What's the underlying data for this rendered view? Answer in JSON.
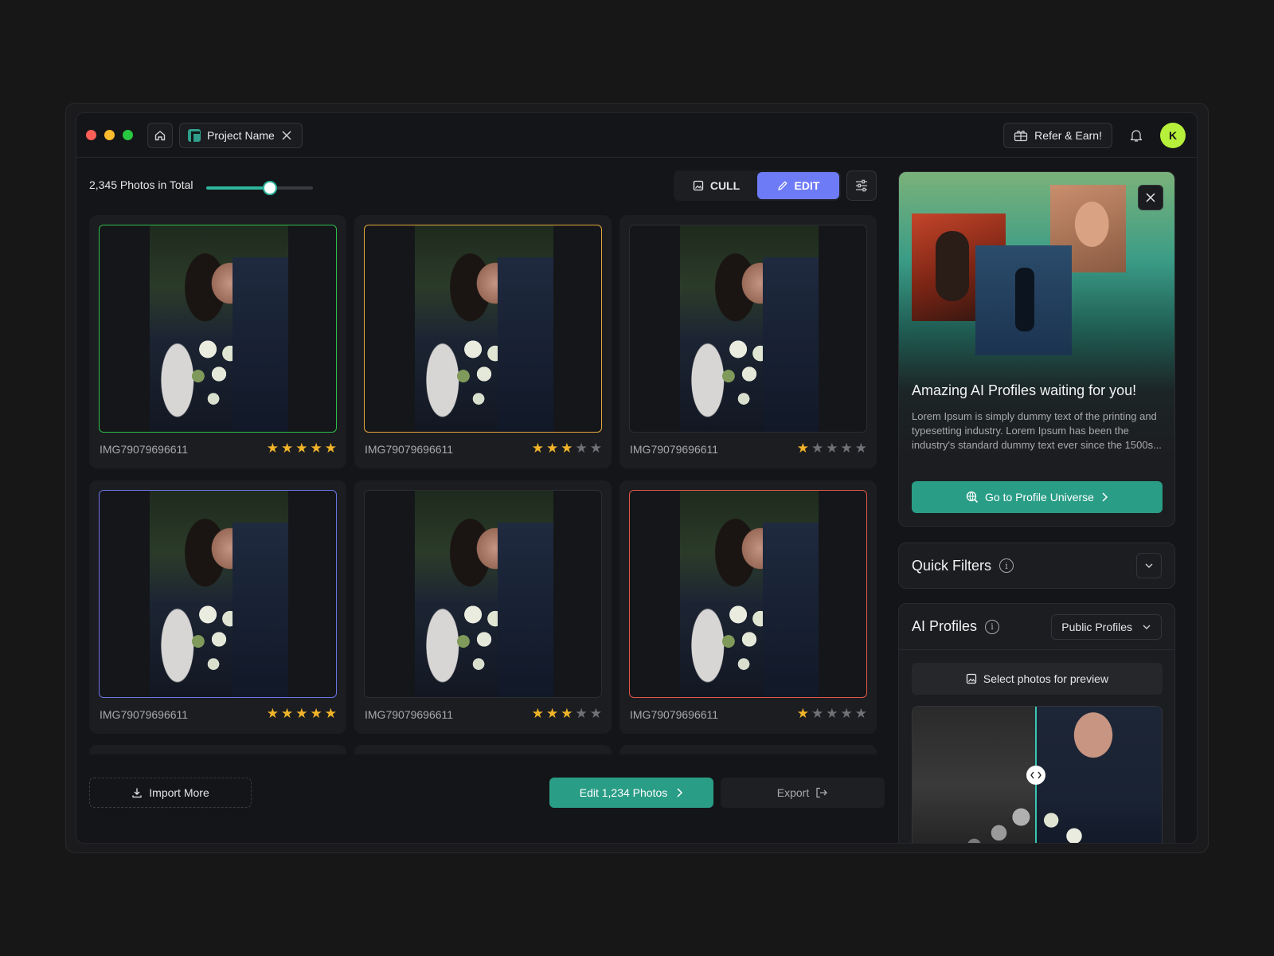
{
  "window": {
    "tab_title": "Project Name",
    "refer_label": "Refer & Earn!",
    "avatar_initial": "K"
  },
  "toolbar": {
    "photos_count": "2,345 Photos in Total",
    "zoom_level": 0.6,
    "cull_label": "CULL",
    "edit_label": "EDIT",
    "active_mode": "EDIT"
  },
  "grid": {
    "photos": [
      {
        "name": "IMG79079696611",
        "rating": 5,
        "border": "#2fbf4a"
      },
      {
        "name": "IMG79079696611",
        "rating": 3,
        "border": "#e2a93b"
      },
      {
        "name": "IMG79079696611",
        "rating": 1,
        "border": "#2c2d32"
      },
      {
        "name": "IMG79079696611",
        "rating": 5,
        "border": "#6c74e8"
      },
      {
        "name": "IMG79079696611",
        "rating": 3,
        "border": "#2c2d32"
      },
      {
        "name": "IMG79079696611",
        "rating": 1,
        "border": "#e0574a"
      }
    ]
  },
  "bottom": {
    "import_label": "Import More",
    "edit_label": "Edit 1,234 Photos",
    "export_label": "Export"
  },
  "promo": {
    "title": "Amazing AI Profiles waiting for you!",
    "body": "Lorem Ipsum is simply dummy text of the printing and typesetting industry. Lorem Ipsum has been the industry's standard dummy text ever since the 1500s...",
    "cta_label": "Go to Profile Universe"
  },
  "quick_filters": {
    "title": "Quick Filters"
  },
  "ai_profiles": {
    "title": "AI Profiles",
    "dropdown_value": "Public Profiles",
    "select_preview_label": "Select photos for preview"
  },
  "colors": {
    "accent_teal": "#2a9d86",
    "accent_purple": "#6e7bf7",
    "star": "#f0b429"
  }
}
